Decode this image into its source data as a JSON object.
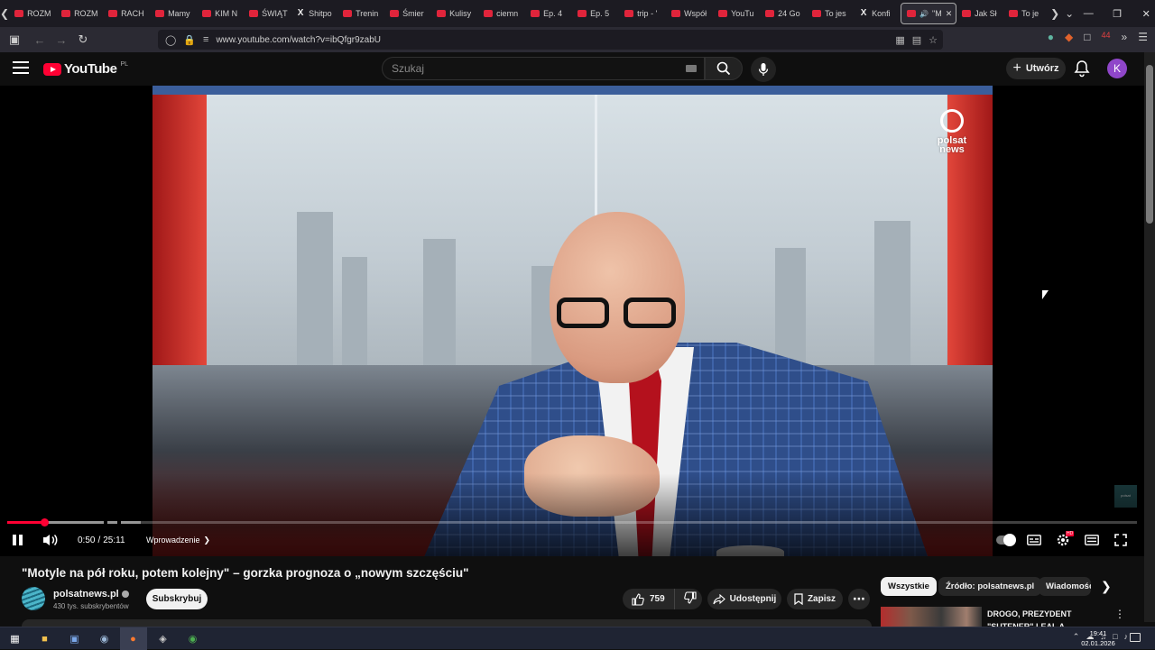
{
  "browser": {
    "tabs": [
      {
        "label": "ROZM",
        "icon": "youtube"
      },
      {
        "label": "ROZM",
        "icon": "youtube"
      },
      {
        "label": "RACH",
        "icon": "youtube"
      },
      {
        "label": "Mamy",
        "icon": "youtube"
      },
      {
        "label": "KIM N",
        "icon": "youtube"
      },
      {
        "label": "ŚWIĄT",
        "icon": "youtube"
      },
      {
        "label": "Shitpo",
        "icon": "x"
      },
      {
        "label": "Trenin",
        "icon": "youtube"
      },
      {
        "label": "Śmier",
        "icon": "youtube"
      },
      {
        "label": "Kulisy",
        "icon": "youtube"
      },
      {
        "label": "ciemn",
        "icon": "youtube"
      },
      {
        "label": "Ep. 4",
        "icon": "youtube"
      },
      {
        "label": "Ep. 5",
        "icon": "youtube"
      },
      {
        "label": "trip - '",
        "icon": "youtube"
      },
      {
        "label": "Współ",
        "icon": "youtube"
      },
      {
        "label": "YouTu",
        "icon": "youtube"
      },
      {
        "label": "24 Go",
        "icon": "youtube"
      },
      {
        "label": "To jes",
        "icon": "youtube"
      },
      {
        "label": "Konfi",
        "icon": "x"
      },
      {
        "label": "\"M",
        "icon": "youtube",
        "active": true
      },
      {
        "label": "Jak Sł",
        "icon": "youtube"
      },
      {
        "label": "To je",
        "icon": "youtube"
      }
    ],
    "url": "www.youtube.com/watch?v=ibQfgr9zabU",
    "extensions_badge": "44"
  },
  "youtube": {
    "logo_text": "YouTube",
    "region": "PL",
    "search_placeholder": "Szukaj",
    "create_label": "Utwórz",
    "avatar_letter": "K"
  },
  "player": {
    "channel_watermark": [
      "polsat",
      "news"
    ],
    "current_time": "0:50",
    "duration": "25:11",
    "time_display": "0:50 / 25:11",
    "chapter_label": "Wprowadzenie",
    "played_fraction": 0.0331,
    "loaded_fraction": 0.118,
    "settings_badge": "HD"
  },
  "video": {
    "title": "\"Motyle na pół roku, potem kolejny\" – gorzka prognoza o „nowym szczęściu\"",
    "channel_name": "polsatnews.pl",
    "subscribers": "430 tys. subskrybentów",
    "subscribe_label": "Subskrybuj",
    "likes": "759",
    "share_label": "Udostępnij",
    "save_label": "Zapisz"
  },
  "sidebar": {
    "chips": [
      "Wszystkie",
      "Źródło: polsatnews.pl",
      "Wiadomości"
    ],
    "selected_chip": "Wszystkie",
    "first_recommendation_title": "DROGO, PREZYDENT \"SUTENER\" LEAL A UKRAIŃCÓ..."
  },
  "taskbar": {
    "time": "19:41",
    "date": "02.01.2026"
  },
  "colors": {
    "youtube_red": "#ff0033",
    "background": "#0f0f0f",
    "avatar": "#8f46c9"
  }
}
